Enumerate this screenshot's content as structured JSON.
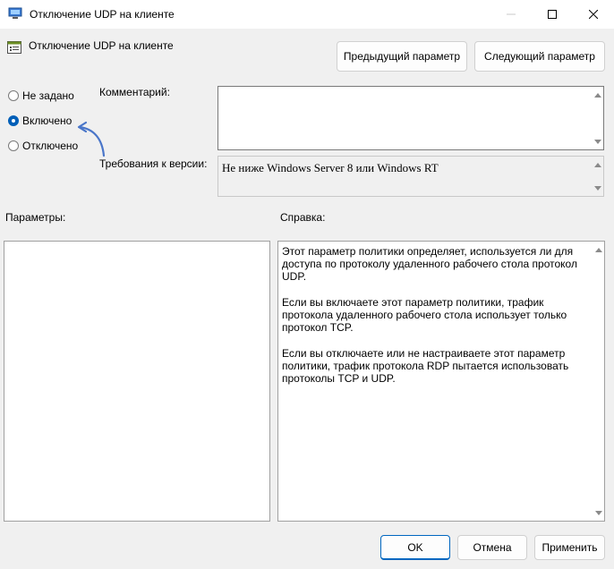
{
  "window": {
    "title": "Отключение UDP на клиенте",
    "controls": [
      "minimize-icon",
      "maximize-icon",
      "close-icon"
    ]
  },
  "policy": {
    "name": "Отключение UDP на клиенте",
    "prev_label": "Предыдущий параметр",
    "next_label": "Следующий параметр"
  },
  "state": {
    "options": [
      {
        "label": "Не задано",
        "selected": false
      },
      {
        "label": "Включено",
        "selected": true
      },
      {
        "label": "Отключено",
        "selected": false
      }
    ]
  },
  "comment": {
    "label": "Комментарий:",
    "value": ""
  },
  "requirements": {
    "label": "Требования к версии:",
    "value": "Не ниже Windows Server 8 или Windows RT"
  },
  "options_panel": {
    "label": "Параметры:"
  },
  "help": {
    "label": "Справка:",
    "paragraphs": [
      "Этот параметр политики определяет, используется ли для доступа по протоколу удаленного рабочего стола протокол UDP.",
      "Если вы включаете этот параметр политики, трафик протокола удаленного рабочего стола использует только протокол TCP.",
      "Если вы отключаете или не настраиваете этот параметр политики, трафик протокола RDP пытается использовать протоколы TCP и UDP."
    ]
  },
  "footer": {
    "ok_label": "OK",
    "cancel_label": "Отмена",
    "apply_label": "Применить"
  },
  "colors": {
    "accent": "#005fb8",
    "arrow": "#4a76c9",
    "window_bg": "#f0f0f0"
  }
}
